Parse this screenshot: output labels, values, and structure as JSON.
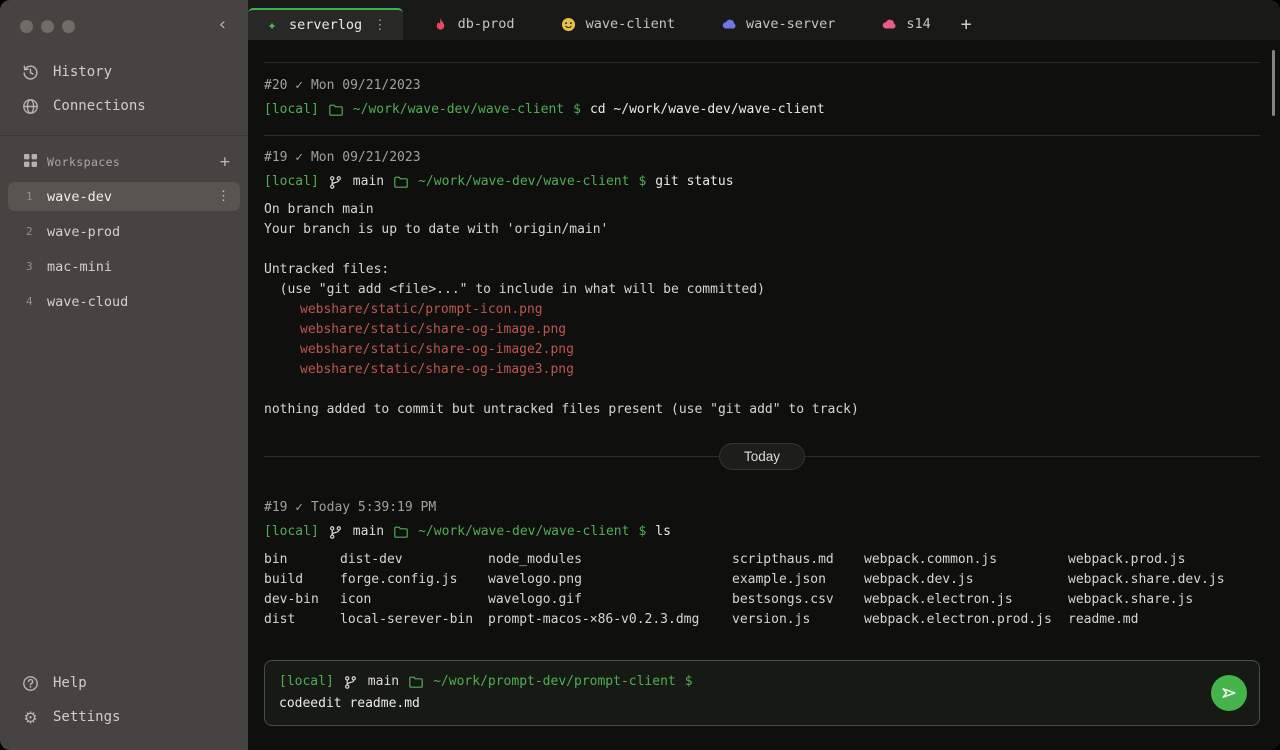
{
  "sidebar": {
    "collapse_icon": "‹",
    "history_label": "History",
    "connections_label": "Connections",
    "workspaces_label": "Workspaces",
    "workspaces_add": "+",
    "workspace_kebab": "⋮",
    "workspaces": [
      {
        "num": "1",
        "name": "wave-dev"
      },
      {
        "num": "2",
        "name": "wave-prod"
      },
      {
        "num": "3",
        "name": "mac-mini"
      },
      {
        "num": "4",
        "name": "wave-cloud"
      }
    ],
    "help_label": "Help",
    "settings_label": "Settings",
    "settings_icon": "⚙"
  },
  "tabs": {
    "items": [
      {
        "label": "serverlog",
        "icon": "sparkle",
        "kebab": "⋮"
      },
      {
        "label": "db-prod",
        "icon": "flame"
      },
      {
        "label": "wave-client",
        "icon": "smiley"
      },
      {
        "label": "wave-server",
        "icon": "cloud-blue"
      },
      {
        "label": "s14",
        "icon": "cloud-pink"
      }
    ],
    "sparkle_glyph": "✦",
    "add_label": "+"
  },
  "terminal": {
    "today_divider": "Today",
    "records": [
      {
        "meta": "#20 ✓ Mon 09/21/2023",
        "host": "[local]",
        "path": "~/work/wave-dev/wave-client",
        "prompt_symbol": "$",
        "command": "cd ~/work/wave-dev/wave-client"
      },
      {
        "meta": "#19 ✓ Mon 09/21/2023",
        "host": "[local]",
        "branch": "main",
        "path": "~/work/wave-dev/wave-client",
        "prompt_symbol": "$",
        "command": "git status",
        "output": {
          "l1": "On branch main",
          "l2": "Your branch is up to date with 'origin/main'",
          "l3": "Untracked files:",
          "l4": "  (use \"git add <file>...\" to include in what will be committed)",
          "files": [
            "webshare/static/prompt-icon.png",
            "webshare/static/share-og-image.png",
            "webshare/static/share-og-image2.png",
            "webshare/static/share-og-image3.png"
          ],
          "l5": "nothing added to commit but untracked files present (use \"git add\" to track)"
        }
      },
      {
        "meta": "#19 ✓ Today 5:39:19 PM",
        "host": "[local]",
        "branch": "main",
        "path": "~/work/wave-dev/wave-client",
        "prompt_symbol": "$",
        "command": "ls",
        "ls_columns": [
          [
            "bin",
            "build",
            "dev-bin",
            "dist"
          ],
          [
            "dist-dev",
            "forge.config.js",
            "icon",
            "local-serever-bin"
          ],
          [
            "node_modules",
            "wavelogo.png",
            "wavelogo.gif",
            "prompt-macos-×86-v0.2.3.dmg"
          ],
          [
            "scripthaus.md",
            "example.json",
            "bestsongs.csv",
            "version.js"
          ],
          [
            "webpack.common.js",
            "webpack.dev.js",
            "webpack.electron.js",
            "webpack.electron.prod.js"
          ],
          [
            "webpack.prod.js",
            "webpack.share.dev.js",
            "webpack.share.js",
            "readme.md"
          ]
        ]
      }
    ]
  },
  "input": {
    "host": "[local]",
    "branch": "main",
    "path": "~/work/prompt-dev/prompt-client",
    "prompt_symbol": "$",
    "command": "codeedit readme.md"
  },
  "colors": {
    "accent_green": "#4fae52",
    "untracked_red": "#bd564d",
    "tab_flame": "#e8485c",
    "tab_smiley": "#e3c14b",
    "tab_cloud_blue": "#7077e0",
    "tab_cloud_pink": "#e85d86"
  }
}
